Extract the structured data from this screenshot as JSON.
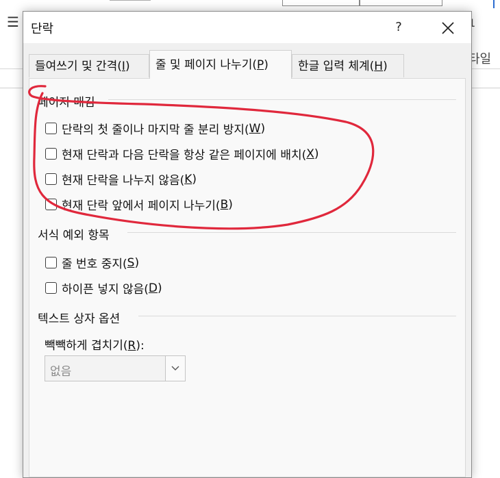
{
  "background": {
    "menu_icon": "hamburger-menu-icon",
    "ribbon_number": "1",
    "ribbon_style": "타일"
  },
  "dialog": {
    "title": "단락",
    "help": "?",
    "close_icon": "close-icon",
    "tabs": [
      {
        "label": "들여쓰기 및 간격(",
        "key": "I",
        "suffix": ")",
        "active": false
      },
      {
        "label": "줄 및 페이지 나누기(",
        "key": "P",
        "suffix": ")",
        "active": true
      },
      {
        "label": "한글 입력 체계(",
        "key": "H",
        "suffix": ")",
        "active": false
      }
    ],
    "pagination": {
      "title": "페이지 매김",
      "options": [
        {
          "label": "단락의 첫 줄이나 마지막 줄 분리 방지(",
          "key": "W",
          "suffix": ")",
          "checked": false
        },
        {
          "label": "현재 단락과 다음 단락을 항상 같은 페이지에 배치(",
          "key": "X",
          "suffix": ")",
          "checked": false
        },
        {
          "label": "현재 단락을 나누지 않음(",
          "key": "K",
          "suffix": ")",
          "checked": false
        },
        {
          "label": "현재 단락 앞에서 페이지 나누기(",
          "key": "B",
          "suffix": ")",
          "checked": false
        }
      ]
    },
    "formatting_exceptions": {
      "title": "서식 예외 항목",
      "options": [
        {
          "label": "줄 번호 중지(",
          "key": "S",
          "suffix": ")",
          "checked": false
        },
        {
          "label": "하이픈 넣지 않음(",
          "key": "D",
          "suffix": ")",
          "checked": false
        }
      ]
    },
    "textbox_options": {
      "title": "텍스트 상자 옵션",
      "tight_wrap_label": "빽빽하게 겹치기(",
      "tight_wrap_key": "R",
      "tight_wrap_suffix": "):",
      "tight_wrap_value": "없음"
    }
  },
  "colors": {
    "annotation": "#e0283c",
    "dialog_bg": "#f0f0f0",
    "panel_bg": "#f9f9f9"
  }
}
